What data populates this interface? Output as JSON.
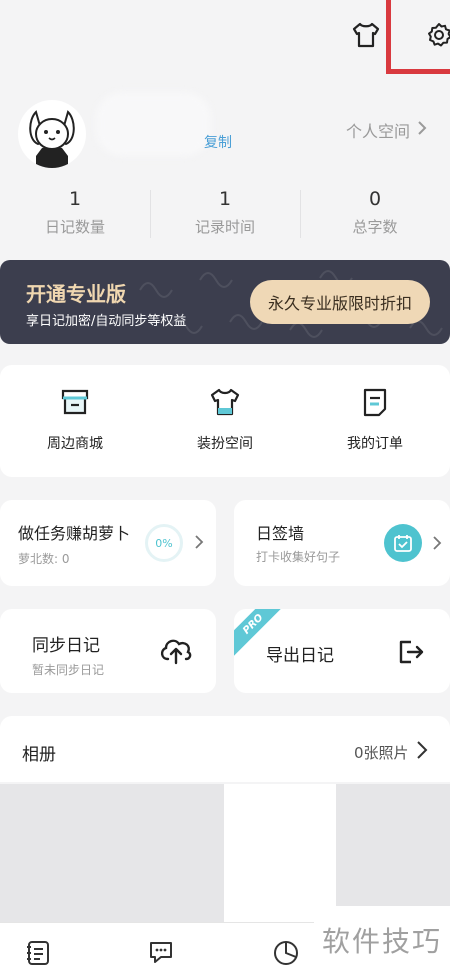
{
  "header": {
    "shirt_icon": "tshirt-icon",
    "settings_icon": "gear-icon",
    "highlight_color": "#d9393f"
  },
  "profile": {
    "copy_label": "复制",
    "personal_space_label": "个人空间"
  },
  "stats": [
    {
      "value": "1",
      "label": "日记数量"
    },
    {
      "value": "1",
      "label": "记录时间"
    },
    {
      "value": "0",
      "label": "总字数"
    }
  ],
  "pro_banner": {
    "title": "开通专业版",
    "subtitle": "享日记加密/自动同步等权益",
    "button_label": "永久专业版限时折扣",
    "background": "#3c3e4e",
    "accent": "#efd8b6"
  },
  "quick_links": [
    {
      "label": "周边商城",
      "icon": "store-icon"
    },
    {
      "label": "装扮空间",
      "icon": "tshirt-icon"
    },
    {
      "label": "我的订单",
      "icon": "order-icon"
    }
  ],
  "tasks": {
    "title": "做任务赚胡萝卜",
    "sub": "萝北数: 0",
    "progress_label": "0%",
    "progress": 0
  },
  "sign_wall": {
    "title": "日签墙",
    "sub": "打卡收集好句子",
    "accent": "#4ec3cf"
  },
  "sync": {
    "title": "同步日记",
    "sub": "暂未同步日记"
  },
  "export": {
    "title": "导出日记",
    "badge": "PRO",
    "badge_color": "#5fc8d6"
  },
  "album": {
    "title": "相册",
    "count_label": "0张照片"
  },
  "nav": {
    "items": [
      "diary-list-icon",
      "chat-icon",
      "pie-chart-icon"
    ]
  },
  "watermark": {
    "text": "软件技巧"
  }
}
